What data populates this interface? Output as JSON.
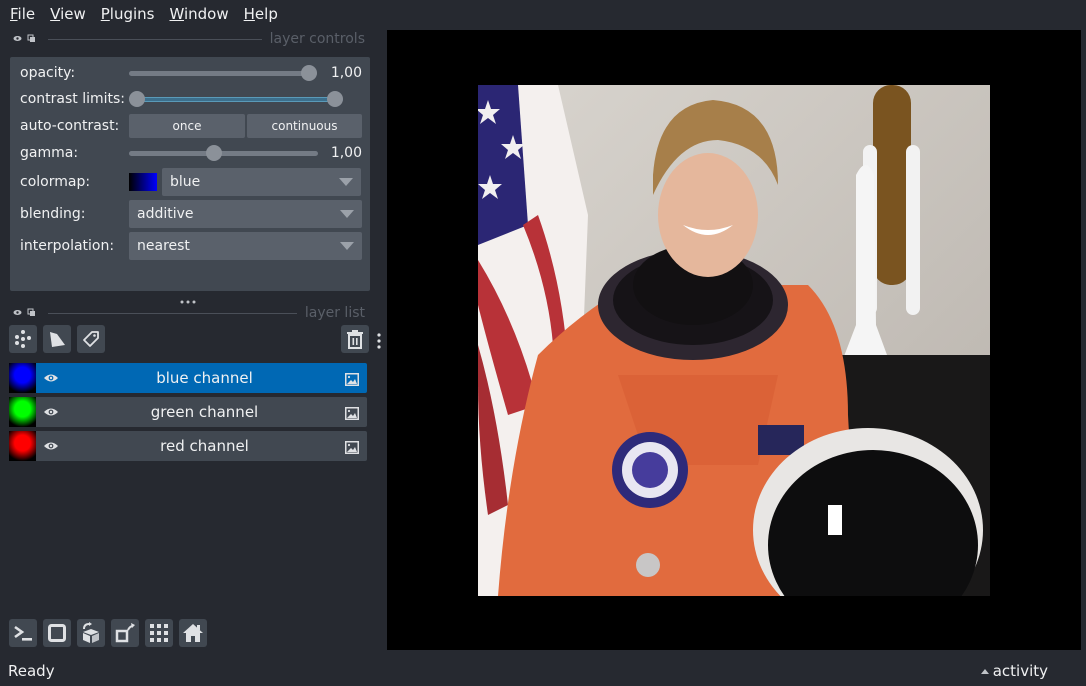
{
  "menubar": {
    "items": [
      {
        "label": "File",
        "mnemonic": "F",
        "rest": "ile"
      },
      {
        "label": "View",
        "mnemonic": "V",
        "rest": "iew"
      },
      {
        "label": "Plugins",
        "mnemonic": "P",
        "rest": "lugins"
      },
      {
        "label": "Window",
        "mnemonic": "W",
        "rest": "indow"
      },
      {
        "label": "Help",
        "mnemonic": "H",
        "rest": "elp"
      }
    ]
  },
  "layer_controls": {
    "title": "layer controls",
    "opacity": {
      "label": "opacity:",
      "value": 1.0,
      "display": "1,00"
    },
    "contrast_limits": {
      "label": "contrast limits:",
      "low": 0.0,
      "high": 1.0
    },
    "auto_contrast": {
      "label": "auto-contrast:",
      "once": "once",
      "continuous": "continuous"
    },
    "gamma": {
      "label": "gamma:",
      "value": 1.0,
      "display": "1,00",
      "fraction": 0.45
    },
    "colormap": {
      "label": "colormap:",
      "value": "blue",
      "swatch_color": "#0000ff"
    },
    "blending": {
      "label": "blending:",
      "value": "additive"
    },
    "interpolation": {
      "label": "interpolation:",
      "value": "nearest"
    }
  },
  "layer_list": {
    "title": "layer list",
    "buttons": [
      "new-points-layer",
      "new-shapes-layer",
      "new-labels-layer",
      "delete-layer"
    ],
    "layers": [
      {
        "name": "blue channel",
        "visible": true,
        "selected": true,
        "color": "#0000ff"
      },
      {
        "name": "green channel",
        "visible": true,
        "selected": false,
        "color": "#00ff00"
      },
      {
        "name": "red channel",
        "visible": true,
        "selected": false,
        "color": "#ff0000"
      }
    ]
  },
  "viewer_buttons": [
    "console",
    "ndisplay-2d",
    "roll-dimensions",
    "transpose-dimensions",
    "grid-mode",
    "home"
  ],
  "status": {
    "text": "Ready",
    "activity": "activity"
  },
  "colors": {
    "accent": "#0068b4",
    "background": "#262930",
    "panel": "#414851"
  }
}
